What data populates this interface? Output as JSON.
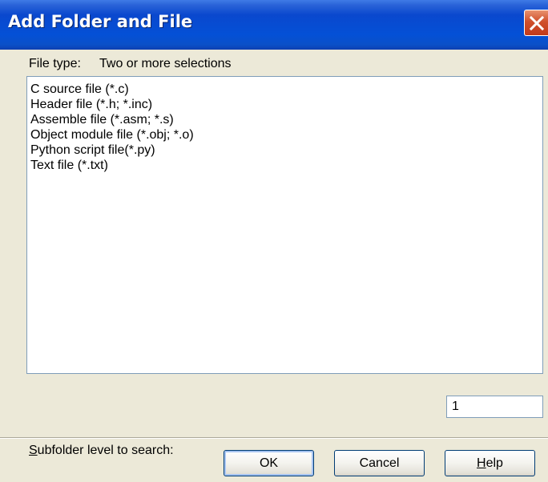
{
  "window": {
    "title": "Add Folder and File"
  },
  "file_type": {
    "label": "File type:",
    "value": "Two or more selections"
  },
  "file_types": [
    {
      "label": "C source file (*.c)"
    },
    {
      "label": "Header file (*.h; *.inc)"
    },
    {
      "label": "Assemble file (*.asm; *.s)"
    },
    {
      "label": "Object module file (*.obj; *.o)"
    },
    {
      "label": "Python script file(*.py)"
    },
    {
      "label": "Text file (*.txt)"
    }
  ],
  "subfolder": {
    "label_prefix": "S",
    "label_rest": "ubfolder level to search:",
    "value": "1"
  },
  "buttons": {
    "ok": "OK",
    "cancel": "Cancel",
    "help_prefix": "H",
    "help_rest": "elp"
  }
}
